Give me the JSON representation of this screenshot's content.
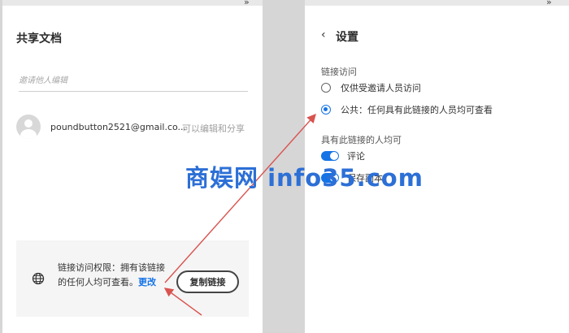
{
  "left": {
    "title": "共享文档",
    "invite_placeholder": "邀请他人编辑",
    "user": {
      "email": "poundbutton2521@gmail.co...",
      "permission": "可以编辑和分享"
    },
    "link_access": {
      "text": "链接访问权限：拥有该链接的任何人均可查看。",
      "change_label": "更改",
      "copy_button": "复制链接",
      "icon": "globe-icon"
    }
  },
  "right": {
    "back_icon": "‹",
    "title": "设置",
    "link_access_label": "链接访问",
    "options": [
      {
        "label": "仅供受邀请人员访问",
        "selected": false
      },
      {
        "label": "公共：任何具有此链接的人员均可查看",
        "selected": true
      }
    ],
    "permissions_label": "具有此链接的人均可",
    "toggles": [
      {
        "label": "评论",
        "on": true
      },
      {
        "label": "保存副本",
        "on": true
      }
    ]
  },
  "top_arrows": "»",
  "watermark": "商娱网 info35.com",
  "colors": {
    "accent": "#1473e6",
    "annotation_arrow": "#d9534f",
    "watermark": "#2c6fd6"
  }
}
